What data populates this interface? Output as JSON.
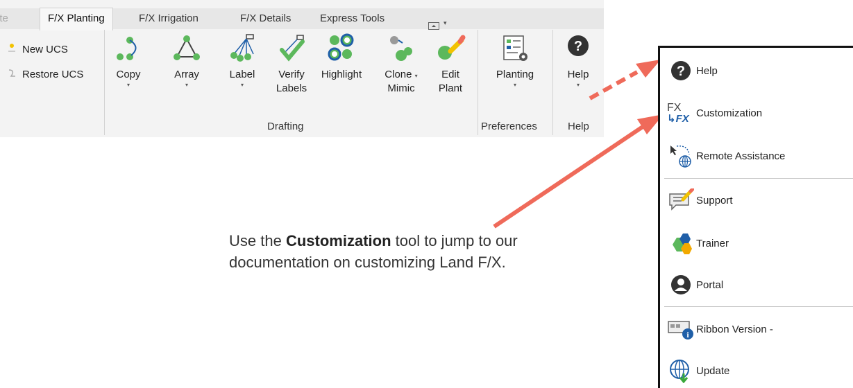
{
  "ribbon": {
    "tabs": [
      "Site",
      "F/X Planting",
      "F/X Irrigation",
      "F/X Details",
      "Express Tools"
    ],
    "active_tab": "F/X Planting",
    "ucs": {
      "new": "New UCS",
      "restore": "Restore UCS"
    },
    "tools": {
      "copy": "Copy",
      "array": "Array",
      "label": "Label",
      "verify_line1": "Verify",
      "verify_line2": "Labels",
      "highlight": "Highlight",
      "clone_line1": "Clone",
      "clone_line2": "Mimic",
      "edit_line1": "Edit",
      "edit_line2": "Plant",
      "planting": "Planting",
      "help": "Help"
    },
    "panels": {
      "drafting": "Drafting",
      "preferences": "Preferences",
      "help": "Help"
    }
  },
  "callout": {
    "prefix": "Use the",
    "bold": "Customization",
    "suffix": "tool to jump to our documentation on customizing Land F/X."
  },
  "help_menu": {
    "items": {
      "help": "Help",
      "customization": "Customization",
      "customization_icon_text": "FX",
      "customization_icon_text2": "FX",
      "remote": "Remote Assistance",
      "support": "Support",
      "trainer": "Trainer",
      "portal": "Portal",
      "ribbon_version": "Ribbon Version -",
      "update": "Update"
    }
  },
  "colors": {
    "accent_green": "#5cb85c",
    "arrow_red": "#ef6a5a",
    "globe_blue": "#1f5fa8"
  }
}
